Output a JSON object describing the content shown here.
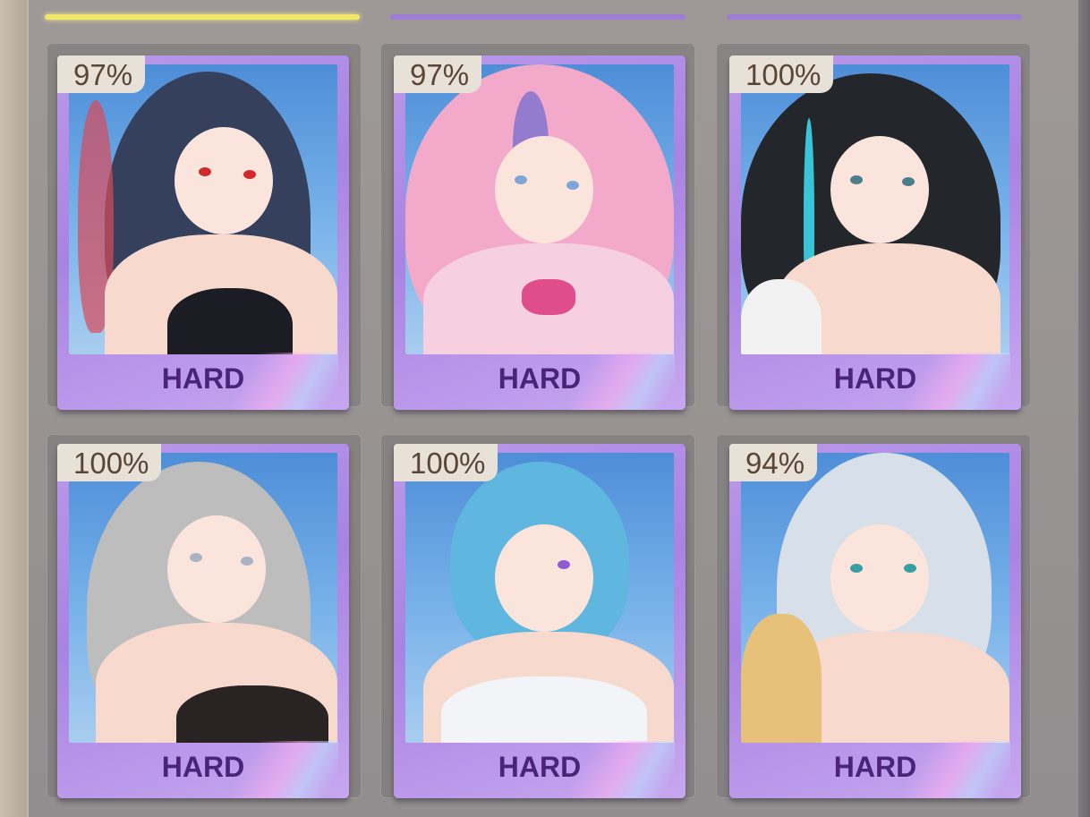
{
  "cards": [
    {
      "percent": "97%",
      "difficulty": "HARD",
      "palette": {
        "hair": "#34405c",
        "accent": "#d94a5a",
        "eyes": "#d12a2a",
        "outfit": "#1c1c24"
      }
    },
    {
      "percent": "97%",
      "difficulty": "HARD",
      "palette": {
        "hair": "#f3a9c9",
        "accent": "#7a6fd0",
        "eyes": "#7fa5d8",
        "outfit": "#f6cfe0"
      }
    },
    {
      "percent": "100%",
      "difficulty": "HARD",
      "palette": {
        "hair": "#23262b",
        "accent": "#39c5d8",
        "eyes": "#4a7f8a",
        "outfit": "#f2f2f2"
      }
    },
    {
      "percent": "100%",
      "difficulty": "HARD",
      "palette": {
        "hair": "#bdbdbd",
        "accent": "#2b2b2b",
        "eyes": "#a9b3c3",
        "outfit": "#2a2324"
      }
    },
    {
      "percent": "100%",
      "difficulty": "HARD",
      "palette": {
        "hair": "#5fb6de",
        "accent": "#1e2a3d",
        "eyes": "#8f5bd1",
        "outfit": "#f2f4f7"
      }
    },
    {
      "percent": "94%",
      "difficulty": "HARD",
      "palette": {
        "hair": "#d7dfe8",
        "accent": "#d7a258",
        "eyes": "#3a9fa3",
        "outfit": "#e7c07a"
      }
    }
  ]
}
